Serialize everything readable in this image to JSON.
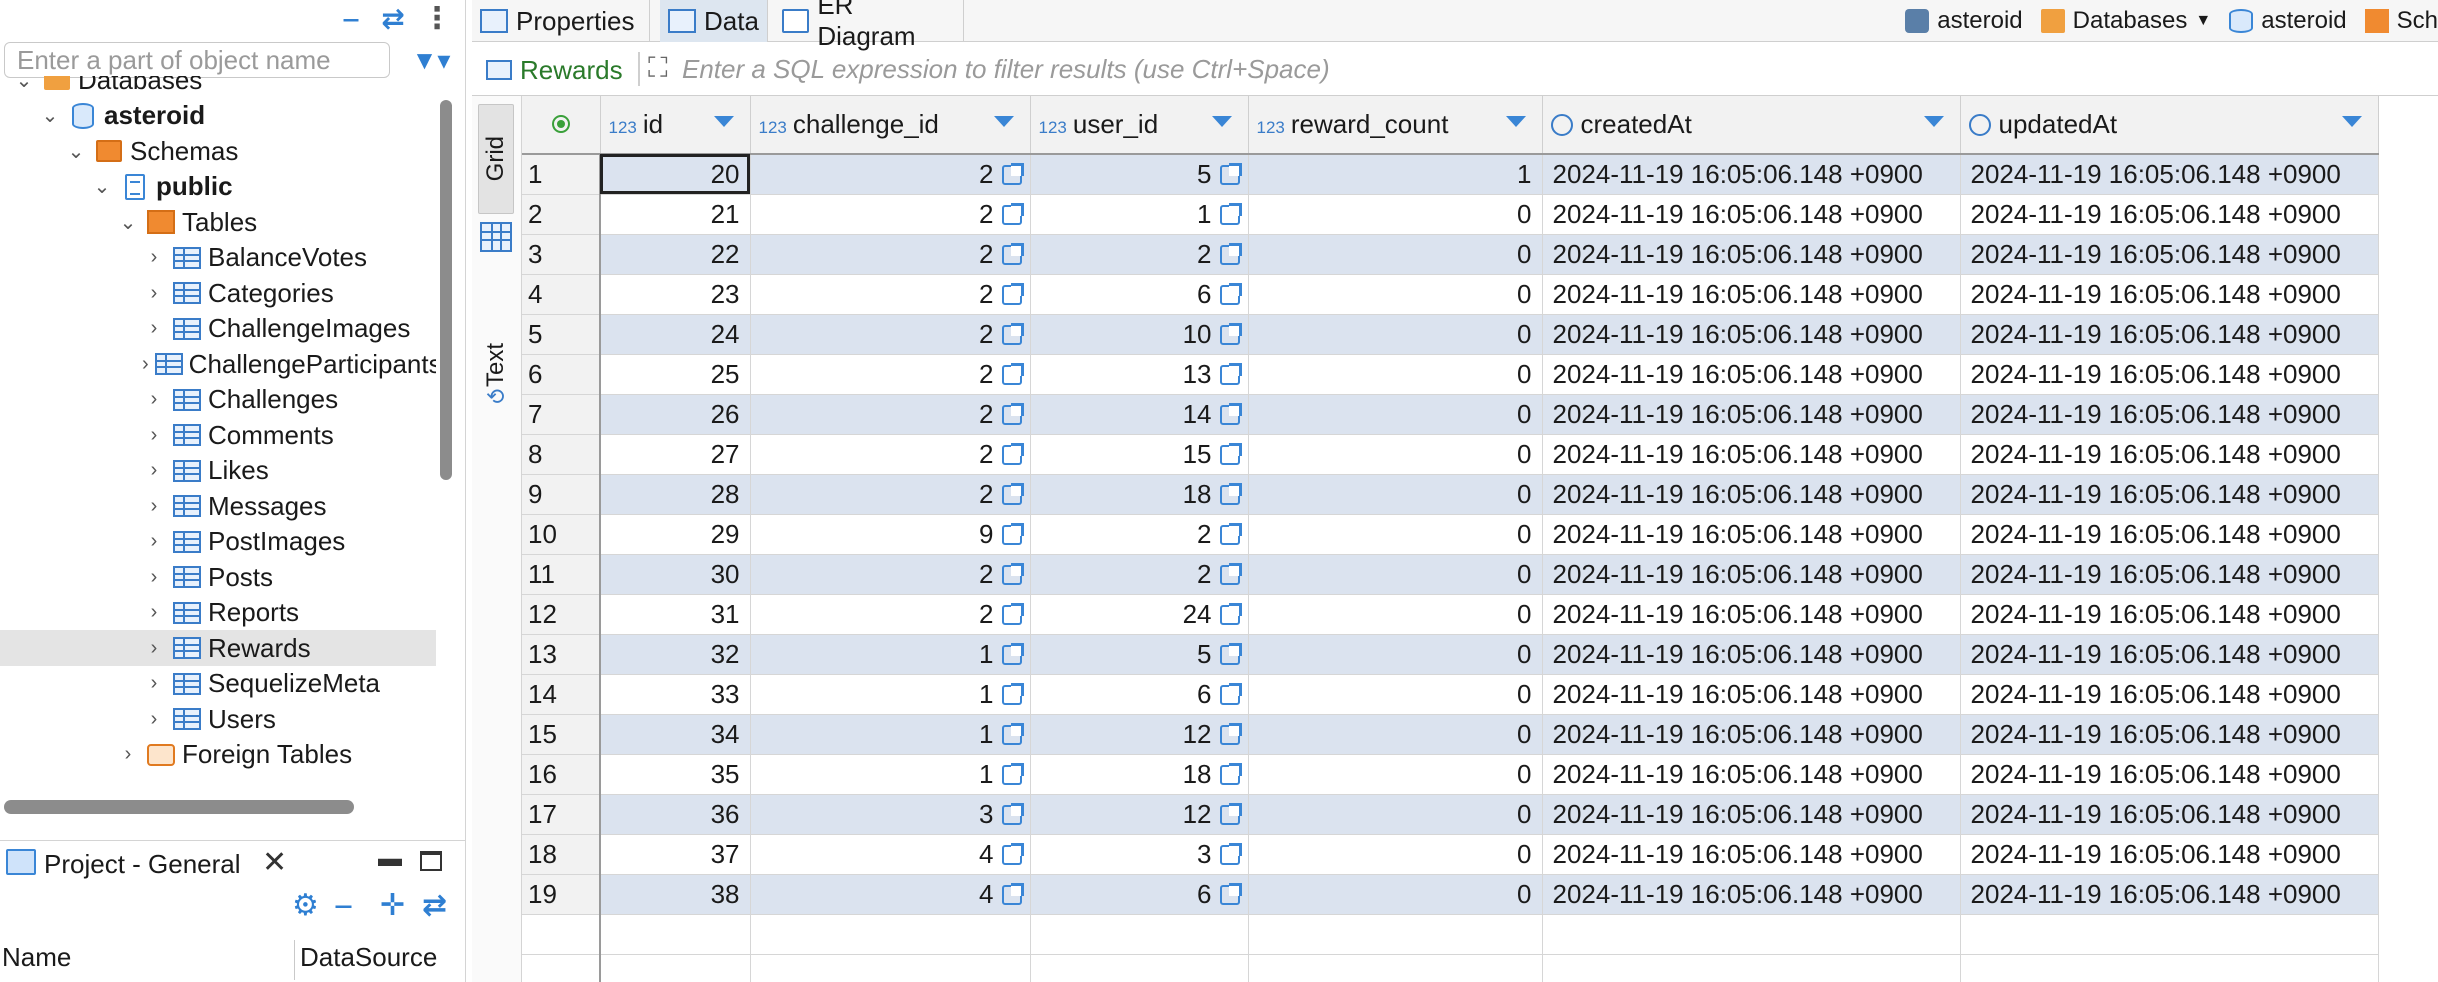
{
  "navigator": {
    "search_placeholder": "Enter a part of object name",
    "tree": [
      {
        "label": "Databases",
        "level": 2,
        "expanded": true,
        "icon": "folder-icon",
        "bold": false
      },
      {
        "label": "asteroid",
        "level": 3,
        "expanded": true,
        "icon": "database-icon",
        "bold": true
      },
      {
        "label": "Schemas",
        "level": 4,
        "expanded": true,
        "icon": "schemas-folder-icon",
        "bold": false
      },
      {
        "label": "public",
        "level": 5,
        "expanded": true,
        "icon": "schema-icon",
        "bold": true
      },
      {
        "label": "Tables",
        "level": 6,
        "expanded": true,
        "icon": "tables-folder-icon",
        "bold": false
      },
      {
        "label": "BalanceVotes",
        "level": 7,
        "expanded": false,
        "icon": "table-icon",
        "bold": false
      },
      {
        "label": "Categories",
        "level": 7,
        "expanded": false,
        "icon": "table-icon",
        "bold": false
      },
      {
        "label": "ChallengeImages",
        "level": 7,
        "expanded": false,
        "icon": "table-icon",
        "bold": false
      },
      {
        "label": "ChallengeParticipants",
        "level": 7,
        "expanded": false,
        "icon": "table-icon",
        "bold": false
      },
      {
        "label": "Challenges",
        "level": 7,
        "expanded": false,
        "icon": "table-icon",
        "bold": false
      },
      {
        "label": "Comments",
        "level": 7,
        "expanded": false,
        "icon": "table-icon",
        "bold": false
      },
      {
        "label": "Likes",
        "level": 7,
        "expanded": false,
        "icon": "table-icon",
        "bold": false
      },
      {
        "label": "Messages",
        "level": 7,
        "expanded": false,
        "icon": "table-icon",
        "bold": false
      },
      {
        "label": "PostImages",
        "level": 7,
        "expanded": false,
        "icon": "table-icon",
        "bold": false
      },
      {
        "label": "Posts",
        "level": 7,
        "expanded": false,
        "icon": "table-icon",
        "bold": false
      },
      {
        "label": "Reports",
        "level": 7,
        "expanded": false,
        "icon": "table-icon",
        "bold": false
      },
      {
        "label": "Rewards",
        "level": 7,
        "expanded": false,
        "icon": "table-icon",
        "bold": false,
        "selected": true
      },
      {
        "label": "SequelizeMeta",
        "level": 7,
        "expanded": false,
        "icon": "table-icon",
        "bold": false
      },
      {
        "label": "Users",
        "level": 7,
        "expanded": false,
        "icon": "table-icon",
        "bold": false
      },
      {
        "label": "Foreign Tables",
        "level": 6,
        "expanded": false,
        "icon": "foreign-tables-icon",
        "bold": false
      }
    ]
  },
  "project": {
    "title": "Project - General",
    "columns": {
      "name": "Name",
      "datasource": "DataSource"
    }
  },
  "editor": {
    "tabs": [
      {
        "label": "Properties",
        "active": false
      },
      {
        "label": "Data",
        "active": true
      },
      {
        "label": "ER Diagram",
        "active": false
      }
    ],
    "connection": {
      "datasource": "asteroid",
      "folder": "Databases",
      "database": "asteroid",
      "schema": "Sch"
    },
    "filter": {
      "table_label": "Rewards",
      "placeholder": "Enter a SQL expression to filter results (use Ctrl+Space)"
    },
    "side_tabs": {
      "grid": "Grid",
      "text": "Text"
    }
  },
  "grid": {
    "type_badge": "123",
    "columns": [
      "id",
      "challenge_id",
      "user_id",
      "reward_count",
      "createdAt",
      "updatedAt"
    ],
    "rows": [
      [
        "1",
        "20",
        "2",
        "5",
        "1",
        "2024-11-19 16:05:06.148 +0900",
        "2024-11-19 16:05:06.148 +0900"
      ],
      [
        "2",
        "21",
        "2",
        "1",
        "0",
        "2024-11-19 16:05:06.148 +0900",
        "2024-11-19 16:05:06.148 +0900"
      ],
      [
        "3",
        "22",
        "2",
        "2",
        "0",
        "2024-11-19 16:05:06.148 +0900",
        "2024-11-19 16:05:06.148 +0900"
      ],
      [
        "4",
        "23",
        "2",
        "6",
        "0",
        "2024-11-19 16:05:06.148 +0900",
        "2024-11-19 16:05:06.148 +0900"
      ],
      [
        "5",
        "24",
        "2",
        "10",
        "0",
        "2024-11-19 16:05:06.148 +0900",
        "2024-11-19 16:05:06.148 +0900"
      ],
      [
        "6",
        "25",
        "2",
        "13",
        "0",
        "2024-11-19 16:05:06.148 +0900",
        "2024-11-19 16:05:06.148 +0900"
      ],
      [
        "7",
        "26",
        "2",
        "14",
        "0",
        "2024-11-19 16:05:06.148 +0900",
        "2024-11-19 16:05:06.148 +0900"
      ],
      [
        "8",
        "27",
        "2",
        "15",
        "0",
        "2024-11-19 16:05:06.148 +0900",
        "2024-11-19 16:05:06.148 +0900"
      ],
      [
        "9",
        "28",
        "2",
        "18",
        "0",
        "2024-11-19 16:05:06.148 +0900",
        "2024-11-19 16:05:06.148 +0900"
      ],
      [
        "10",
        "29",
        "9",
        "2",
        "0",
        "2024-11-19 16:05:06.148 +0900",
        "2024-11-19 16:05:06.148 +0900"
      ],
      [
        "11",
        "30",
        "2",
        "2",
        "0",
        "2024-11-19 16:05:06.148 +0900",
        "2024-11-19 16:05:06.148 +0900"
      ],
      [
        "12",
        "31",
        "2",
        "24",
        "0",
        "2024-11-19 16:05:06.148 +0900",
        "2024-11-19 16:05:06.148 +0900"
      ],
      [
        "13",
        "32",
        "1",
        "5",
        "0",
        "2024-11-19 16:05:06.148 +0900",
        "2024-11-19 16:05:06.148 +0900"
      ],
      [
        "14",
        "33",
        "1",
        "6",
        "0",
        "2024-11-19 16:05:06.148 +0900",
        "2024-11-19 16:05:06.148 +0900"
      ],
      [
        "15",
        "34",
        "1",
        "12",
        "0",
        "2024-11-19 16:05:06.148 +0900",
        "2024-11-19 16:05:06.148 +0900"
      ],
      [
        "16",
        "35",
        "1",
        "18",
        "0",
        "2024-11-19 16:05:06.148 +0900",
        "2024-11-19 16:05:06.148 +0900"
      ],
      [
        "17",
        "36",
        "3",
        "12",
        "0",
        "2024-11-19 16:05:06.148 +0900",
        "2024-11-19 16:05:06.148 +0900"
      ],
      [
        "18",
        "37",
        "4",
        "3",
        "0",
        "2024-11-19 16:05:06.148 +0900",
        "2024-11-19 16:05:06.148 +0900"
      ],
      [
        "19",
        "38",
        "4",
        "6",
        "0",
        "2024-11-19 16:05:06.148 +0900",
        "2024-11-19 16:05:06.148 +0900"
      ]
    ]
  },
  "colors": {
    "accent": "#2f7fd2",
    "row_band": "#dbe3ef",
    "filter_label": "#2a7a2a"
  }
}
